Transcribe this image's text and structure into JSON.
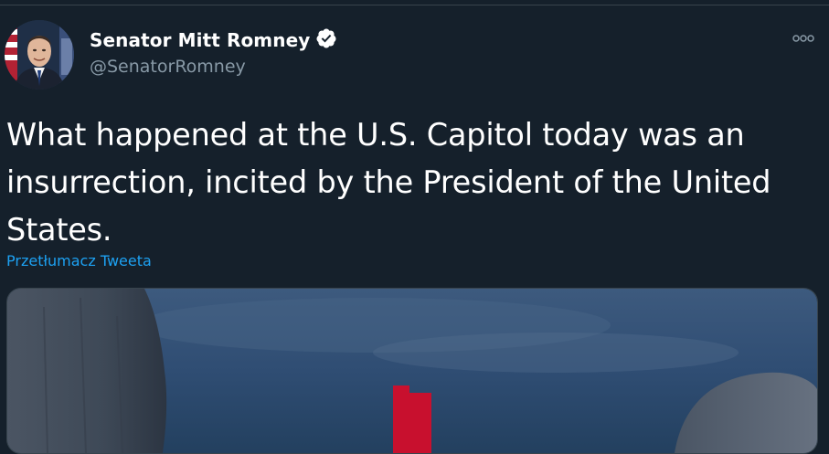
{
  "tweet": {
    "author_name": "Senator Mitt Romney",
    "author_handle": "@SenatorRomney",
    "text": "What happened at the U.S. Capitol today was an insurrection, incited by the President of the United States.",
    "translate_link": "Przetłumacz Tweeta"
  },
  "icons": {
    "verified": "verified-badge-icon",
    "more": "more-options-icon"
  },
  "colors": {
    "background": "#15202b",
    "secondary_text": "#8899a6",
    "link": "#1da1f2",
    "border": "#38444d"
  }
}
